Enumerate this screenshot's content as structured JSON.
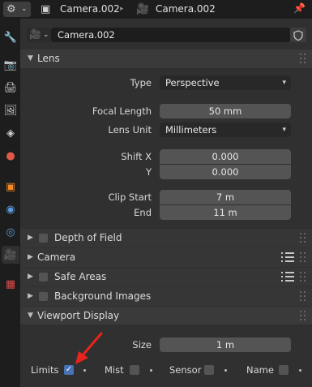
{
  "header": {
    "object_name": "Camera.002",
    "data_name": "Camera.002"
  },
  "datablock": {
    "name": "Camera.002"
  },
  "sidebar": {
    "tabs": [
      "tool-icon",
      "render-icon",
      "output-icon",
      "view-layer-icon",
      "scene-icon",
      "world-icon",
      "object-icon",
      "modifier-icon",
      "physics-icon",
      "camera-data-icon",
      "texture-icon"
    ],
    "active": "camera-data-icon"
  },
  "lens": {
    "title": "Lens",
    "type_label": "Type",
    "type_value": "Perspective",
    "focal_label": "Focal Length",
    "focal_value": "50 mm",
    "unit_label": "Lens Unit",
    "unit_value": "Millimeters",
    "shiftx_label": "Shift X",
    "shiftx_value": "0.000",
    "shifty_label": "Y",
    "shifty_value": "0.000",
    "clipstart_label": "Clip Start",
    "clipstart_value": "7 m",
    "clipend_label": "End",
    "clipend_value": "11 m"
  },
  "panels": {
    "dof": "Depth of Field",
    "camera": "Camera",
    "safe_areas": "Safe Areas",
    "background_images": "Background Images",
    "viewport_display": "Viewport Display"
  },
  "viewport_display": {
    "size_label": "Size",
    "size_value": "1 m",
    "limits_label": "Limits",
    "limits_checked": true,
    "mist_label": "Mist",
    "sensor_label": "Sensor",
    "name_label": "Name"
  },
  "colors": {
    "accent": "#4772b3",
    "annotation_arrow": "#e8231b"
  }
}
